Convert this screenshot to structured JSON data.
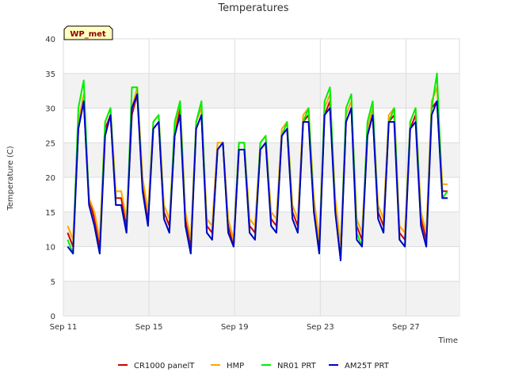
{
  "chart_data": {
    "type": "line",
    "title": "Temperatures",
    "xlabel": "Time",
    "ylabel": "Temperature (C)",
    "tag": "WP_met",
    "xlim": [
      0,
      18.5
    ],
    "ylim": [
      0,
      40
    ],
    "yticks": [
      0,
      5,
      10,
      15,
      20,
      25,
      30,
      35,
      40
    ],
    "xticks": [
      {
        "value": 0,
        "label": "Sep 11"
      },
      {
        "value": 4,
        "label": "Sep 15"
      },
      {
        "value": 8,
        "label": "Sep 19"
      },
      {
        "value": 12,
        "label": "Sep 23"
      },
      {
        "value": 16,
        "label": "Sep 27"
      }
    ],
    "x_unit": "days since Sep 11",
    "grid": true,
    "legend_position": "bottom",
    "series": [
      {
        "name": "CR1000 panelT",
        "color": "#cc0000",
        "values": [
          12,
          10,
          27,
          31,
          17,
          14,
          10,
          27,
          29,
          17,
          17,
          13,
          29,
          32,
          19,
          14,
          27,
          28,
          15,
          13,
          26,
          30,
          14,
          10,
          27,
          29,
          13,
          12,
          24,
          25,
          13,
          10,
          24,
          24,
          13,
          12,
          24,
          25,
          14,
          13,
          26,
          27,
          15,
          13,
          28,
          29,
          16,
          10,
          29,
          31,
          16,
          9,
          28,
          30,
          13,
          11,
          26,
          29,
          15,
          13,
          28,
          29,
          12,
          11,
          27,
          29,
          14,
          11,
          30,
          31,
          18,
          18
        ]
      },
      {
        "name": "HMP",
        "color": "#ffa500",
        "values": [
          13,
          11,
          28,
          32,
          17,
          15,
          11,
          28,
          30,
          18,
          18,
          14,
          30,
          33,
          20,
          15,
          28,
          29,
          16,
          14,
          27,
          31,
          15,
          11,
          28,
          30,
          14,
          13,
          25,
          25,
          14,
          11,
          25,
          25,
          14,
          13,
          25,
          26,
          15,
          14,
          27,
          28,
          16,
          14,
          29,
          30,
          17,
          11,
          30,
          32,
          17,
          10,
          29,
          31,
          14,
          12,
          27,
          30,
          16,
          14,
          29,
          30,
          13,
          12,
          28,
          30,
          15,
          12,
          31,
          33,
          19,
          19
        ]
      },
      {
        "name": "NR01 PRT",
        "color": "#00ee00",
        "values": [
          11,
          9,
          30,
          34,
          16,
          13,
          9,
          28,
          30,
          16,
          16,
          12,
          33,
          33,
          18,
          13,
          28,
          29,
          14,
          12,
          28,
          31,
          13,
          9,
          28,
          31,
          12,
          11,
          24,
          25,
          12,
          10,
          25,
          25,
          12,
          11,
          25,
          26,
          13,
          12,
          26,
          28,
          14,
          12,
          28,
          30,
          15,
          9,
          31,
          33,
          15,
          8,
          30,
          32,
          12,
          10,
          28,
          31,
          14,
          12,
          28,
          30,
          11,
          10,
          28,
          30,
          13,
          10,
          30,
          35,
          17,
          18
        ]
      },
      {
        "name": "AM25T PRT",
        "color": "#0000cc",
        "values": [
          10,
          9,
          27,
          31,
          16,
          13,
          9,
          26,
          29,
          16,
          16,
          12,
          30,
          32,
          18,
          13,
          27,
          28,
          14,
          12,
          26,
          29,
          13,
          9,
          27,
          29,
          12,
          11,
          24,
          25,
          12,
          10,
          24,
          24,
          12,
          11,
          24,
          25,
          13,
          12,
          26,
          27,
          14,
          12,
          28,
          28,
          15,
          9,
          29,
          30,
          15,
          8,
          28,
          30,
          11,
          10,
          26,
          29,
          14,
          12,
          28,
          28,
          11,
          10,
          27,
          28,
          13,
          10,
          29,
          31,
          17,
          17
        ]
      }
    ]
  }
}
